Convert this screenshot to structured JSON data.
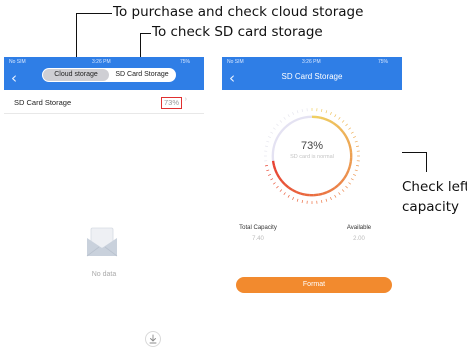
{
  "annotations": {
    "cloud_storage_note": "To purchase and check cloud storage",
    "sd_card_note": "To check SD card storage",
    "capacity_note_line1": "Check left",
    "capacity_note_line2": "capacity"
  },
  "left_screen": {
    "status": {
      "carrier": "No SIM",
      "time": "3:26 PM",
      "battery": "75%"
    },
    "segments": [
      "Cloud storage",
      "SD Card Storage"
    ],
    "selected_segment": "SD Card Storage",
    "row": {
      "label": "SD Card Storage",
      "value": "73%"
    },
    "empty_state_text": "No data",
    "icons": {
      "back": "chevron-left-icon",
      "empty": "envelope-icon",
      "download": "download-icon"
    }
  },
  "right_screen": {
    "status": {
      "carrier": "No SIM",
      "time": "3:26 PM",
      "battery": "75%"
    },
    "title": "SD Card Storage",
    "gauge": {
      "value_text": "73%",
      "fraction": 0.73,
      "status_text": "SD card is normal"
    },
    "capacity": {
      "total_label": "Total Capacity",
      "total_value": "7.40",
      "available_label": "Available",
      "available_value": "2.00"
    },
    "format_label": "Format"
  },
  "colors": {
    "nav_blue": "#2f7ee6",
    "format_orange": "#f28a2e",
    "highlight_red": "#e03030",
    "gauge_yellow": "#f0d060",
    "gauge_red": "#e84030",
    "gauge_track": "#e4e2f2"
  }
}
